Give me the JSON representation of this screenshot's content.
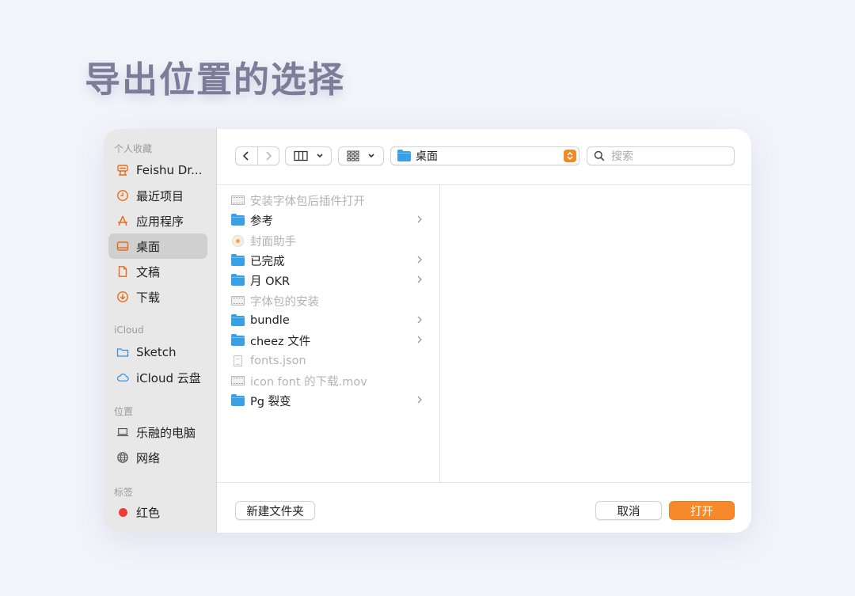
{
  "heading": "导出位置的选择",
  "colors": {
    "accent": "#f7892a",
    "sidebar_icon": "#e76b1c",
    "folder": "#3aa0e6",
    "tag_red": "#ee3b3b"
  },
  "sidebar": {
    "favorites_label": "个人收藏",
    "favorites": [
      {
        "label": "Feishu Dr...",
        "icon": "feishu-drive-icon"
      },
      {
        "label": "最近项目",
        "icon": "clock-icon"
      },
      {
        "label": "应用程序",
        "icon": "applications-icon"
      },
      {
        "label": "桌面",
        "icon": "desktop-icon",
        "selected": true
      },
      {
        "label": "文稿",
        "icon": "document-icon"
      },
      {
        "label": "下载",
        "icon": "download-icon"
      }
    ],
    "icloud_label": "iCloud",
    "icloud": [
      {
        "label": "Sketch",
        "icon": "folder-outline-icon"
      },
      {
        "label": "iCloud 云盘",
        "icon": "cloud-icon"
      }
    ],
    "locations_label": "位置",
    "locations": [
      {
        "label": "乐融的电脑",
        "icon": "computer-icon"
      },
      {
        "label": "网络",
        "icon": "globe-icon"
      }
    ],
    "tags_label": "标签",
    "tags": [
      {
        "label": "红色",
        "color": "#ee3b3b"
      }
    ]
  },
  "toolbar": {
    "location": "桌面",
    "search_placeholder": "搜索"
  },
  "files": [
    {
      "name": "安装字体包后插件打开",
      "type": "movie",
      "enabled": false,
      "has_children": false
    },
    {
      "name": "参考",
      "type": "folder",
      "enabled": true,
      "has_children": true
    },
    {
      "name": "封面助手",
      "type": "app",
      "enabled": false,
      "has_children": false
    },
    {
      "name": "已完成",
      "type": "folder",
      "enabled": true,
      "has_children": true
    },
    {
      "name": "月 OKR",
      "type": "folder",
      "enabled": true,
      "has_children": true
    },
    {
      "name": "字体包的安装",
      "type": "movie",
      "enabled": false,
      "has_children": false
    },
    {
      "name": "bundle",
      "type": "folder",
      "enabled": true,
      "has_children": true
    },
    {
      "name": "cheez 文件",
      "type": "folder",
      "enabled": true,
      "has_children": true
    },
    {
      "name": "fonts.json",
      "type": "doc",
      "enabled": false,
      "has_children": false
    },
    {
      "name": "icon font 的下载.mov",
      "type": "movie",
      "enabled": false,
      "has_children": false
    },
    {
      "name": "Pg 裂变",
      "type": "folder",
      "enabled": true,
      "has_children": true
    }
  ],
  "buttons": {
    "new_folder": "新建文件夹",
    "cancel": "取消",
    "open": "打开"
  }
}
